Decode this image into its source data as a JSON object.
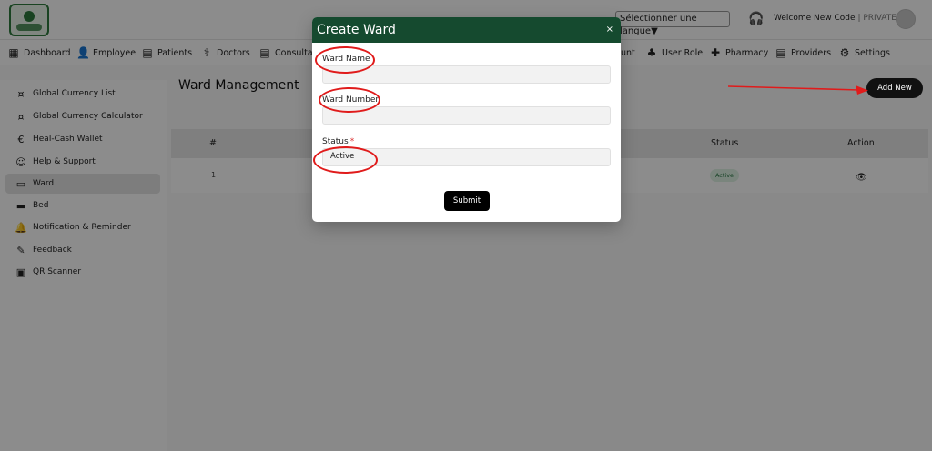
{
  "header": {
    "language_select": "Sélectionner une langue",
    "language_arrow": "▼",
    "welcome_text": "Welcome New Code",
    "separator": "|",
    "role_text": "PRIVATE"
  },
  "nav": {
    "items": [
      {
        "label": "Dashboard",
        "icon": "dashboard-icon"
      },
      {
        "label": "Employee",
        "icon": "employee-icon"
      },
      {
        "label": "Patients",
        "icon": "patients-icon"
      },
      {
        "label": "Doctors",
        "icon": "doctors-icon"
      },
      {
        "label": "Consultat",
        "icon": "consultation-icon"
      },
      {
        "label": "unt",
        "icon": "account-icon"
      },
      {
        "label": "User Role",
        "icon": "user-role-icon"
      },
      {
        "label": "Pharmacy",
        "icon": "pharmacy-icon"
      },
      {
        "label": "Providers",
        "icon": "providers-icon"
      },
      {
        "label": "Settings",
        "icon": "settings-icon"
      }
    ]
  },
  "sidebar": {
    "items": [
      {
        "label": "Global Currency List",
        "icon": "currency-list-icon"
      },
      {
        "label": "Global Currency Calculator",
        "icon": "currency-calculator-icon"
      },
      {
        "label": "Heal-Cash Wallet",
        "icon": "wallet-icon"
      },
      {
        "label": "Help & Support",
        "icon": "support-icon"
      },
      {
        "label": "Ward",
        "icon": "ward-icon",
        "active": true
      },
      {
        "label": "Bed",
        "icon": "bed-icon"
      },
      {
        "label": "Notification & Reminder",
        "icon": "bell-icon"
      },
      {
        "label": "Feedback",
        "icon": "feedback-icon"
      },
      {
        "label": "QR Scanner",
        "icon": "qr-icon"
      }
    ]
  },
  "main": {
    "title": "Ward Management",
    "add_new_label": "Add New"
  },
  "table": {
    "columns": [
      "#",
      "Status",
      "Action"
    ],
    "rows": [
      {
        "index": "1",
        "status": "Active"
      }
    ]
  },
  "modal": {
    "title": "Create Ward",
    "close_label": "×",
    "ward_name_label": "Ward Name",
    "ward_name_value": "",
    "ward_number_label": "Ward Number",
    "ward_number_value": "",
    "status_label": "Status",
    "status_required": "*",
    "status_value": "Active",
    "submit_label": "Submit"
  },
  "colors": {
    "modal_header": "#154a2f",
    "annotation": "#e01b1b",
    "badge_bg": "#dff2e4",
    "badge_text": "#2b7a45"
  }
}
